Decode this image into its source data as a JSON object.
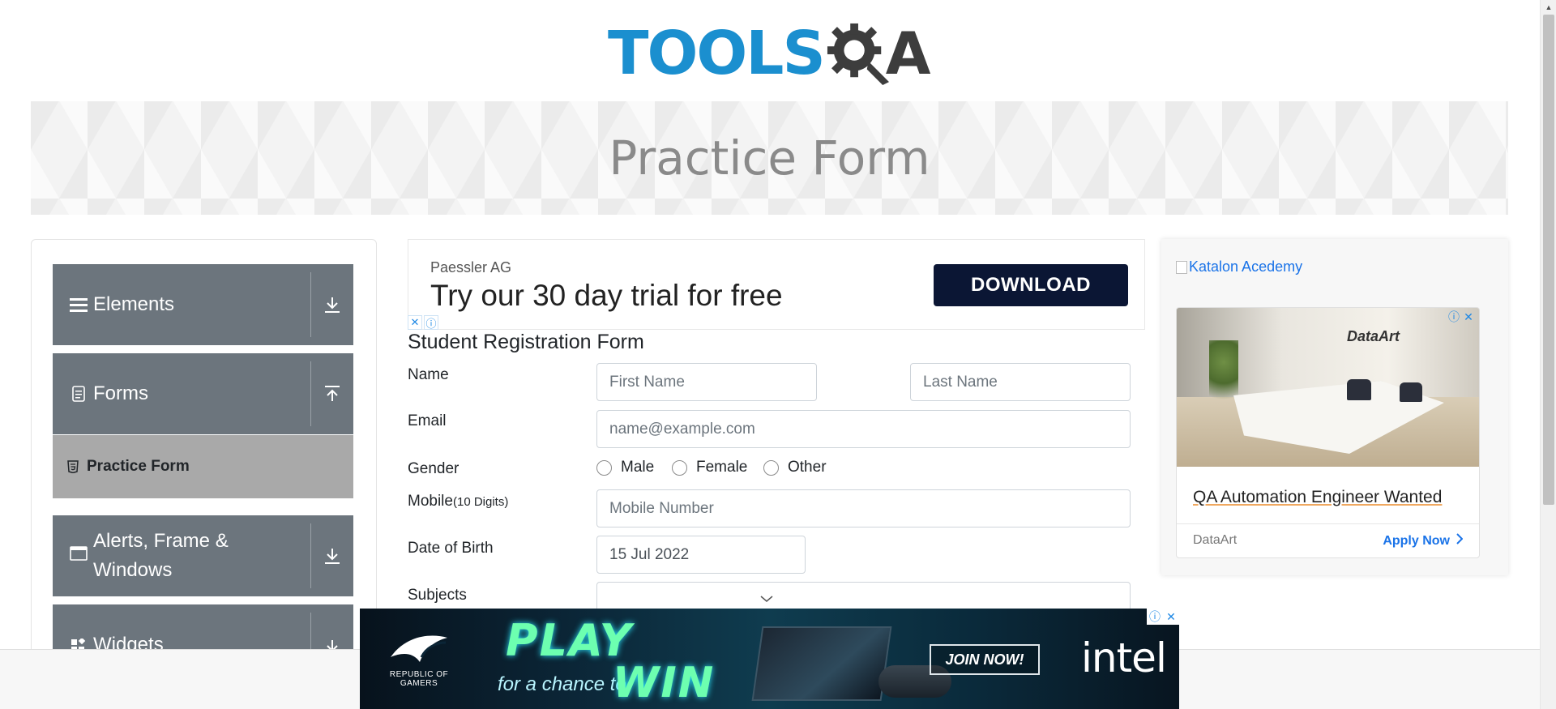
{
  "logo": {
    "part1": "TOOLS",
    "part2": "A"
  },
  "banner": {
    "title": "Practice Form"
  },
  "sidebar": {
    "groups": [
      {
        "label": "Elements",
        "icon": "menu-icon",
        "arrow": "download-arrow-icon"
      },
      {
        "label": "Forms",
        "icon": "document-icon",
        "arrow": "upload-arrow-icon"
      },
      {
        "label": "Alerts, Frame & Windows",
        "icon": "window-icon",
        "arrow": "download-arrow-icon"
      },
      {
        "label": "Widgets",
        "icon": "widgets-icon",
        "arrow": "download-arrow-icon"
      }
    ],
    "sub_items": [
      {
        "label": "Practice Form",
        "icon": "html5-icon",
        "active": true
      }
    ]
  },
  "top_ad": {
    "company": "Paessler AG",
    "headline": "Try our 30 day trial for free",
    "button": "DOWNLOAD"
  },
  "form": {
    "title": "Student Registration Form",
    "name_label": "Name",
    "first_name_placeholder": "First Name",
    "last_name_placeholder": "Last Name",
    "email_label": "Email",
    "email_placeholder": "name@example.com",
    "gender_label": "Gender",
    "gender_options": [
      "Male",
      "Female",
      "Other"
    ],
    "mobile_label": "Mobile",
    "mobile_hint": "(10 Digits)",
    "mobile_placeholder": "Mobile Number",
    "dob_label": "Date of Birth",
    "dob_value": "15 Jul 2022",
    "subjects_label": "Subjects"
  },
  "right_ad": {
    "broken_image_alt": "Katalon Acedemy",
    "photo_brand": "DataArt",
    "card_title": "QA Automation Engineer Wanted",
    "advertiser": "DataArt",
    "cta": "Apply Now"
  },
  "bottom_ad": {
    "brand_small": "REPUBLIC OF GAMERS",
    "play": "PLAY",
    "chance": "for a chance to",
    "win": "WIN",
    "join": "JOIN NOW!",
    "intel": "intel"
  },
  "colors": {
    "logo_blue": "#1b8fcf",
    "logo_dark": "#3d3d3d",
    "sidebar_group": "#6c757d",
    "sidebar_active": "#a9a9a9",
    "download_btn": "#0b1634",
    "link_blue": "#1a73e8"
  }
}
